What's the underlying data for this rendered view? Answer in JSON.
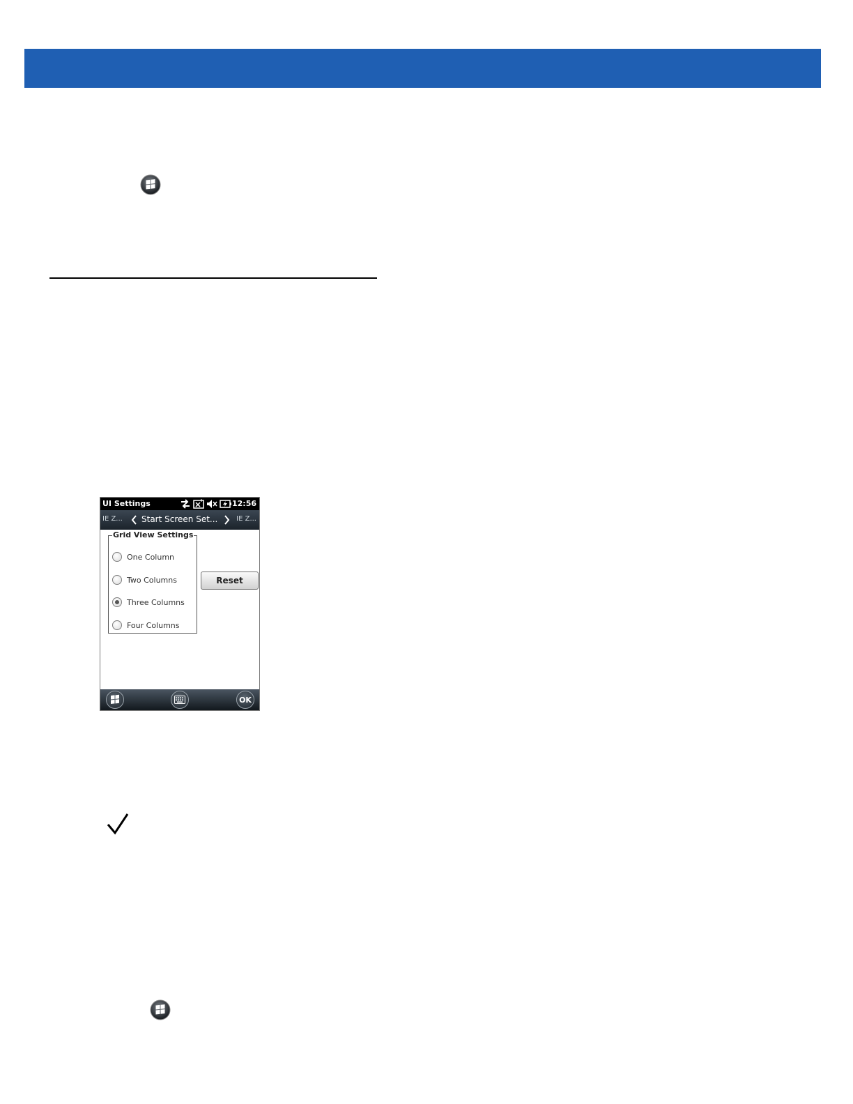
{
  "page": {
    "header_band_color": "#1f5fb3",
    "start_icon": "windows-start-icon",
    "note_icon": "checkmark-icon"
  },
  "device": {
    "status_bar": {
      "title": "UI Settings",
      "time": "12:56",
      "icons": [
        "connectivity-icon",
        "no-signal-icon",
        "speaker-muted-icon",
        "battery-charging-icon"
      ]
    },
    "tabs": {
      "left": "IE Z...",
      "current": "Start Screen Set...",
      "right": "IE Z..."
    },
    "group": {
      "legend": "Grid View Settings",
      "options": [
        {
          "label": "One Column",
          "checked": false
        },
        {
          "label": "Two Columns",
          "checked": false
        },
        {
          "label": "Three Columns",
          "checked": true
        },
        {
          "label": "Four Columns",
          "checked": false
        }
      ]
    },
    "reset_button": "Reset",
    "softkeys": {
      "start": "windows-start-icon",
      "keyboard": "keyboard-icon",
      "ok": "OK"
    }
  }
}
